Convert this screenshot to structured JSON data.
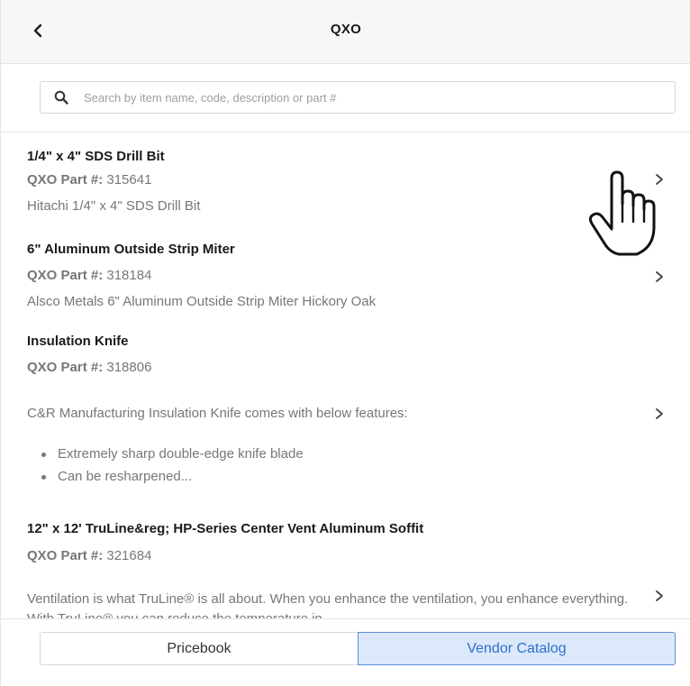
{
  "header": {
    "title": "QXO",
    "back_icon": "chevron-left-icon"
  },
  "search": {
    "placeholder": "Search by item name, code, description or part #",
    "value": "",
    "icon": "search-icon"
  },
  "items": [
    {
      "title": "1/4\" x 4\" SDS Drill Bit",
      "part_label": "QXO Part #:",
      "part_number": "315641",
      "description": "Hitachi 1/4\" x 4\" SDS Drill Bit"
    },
    {
      "title": "6\" Aluminum Outside Strip Miter",
      "part_label": "QXO Part #:",
      "part_number": "318184",
      "description": "Alsco Metals 6\" Aluminum Outside Strip Miter Hickory Oak"
    },
    {
      "title": "Insulation Knife",
      "part_label": "QXO Part #:",
      "part_number": "318806",
      "description": "C&R Manufacturing Insulation Knife comes with below features:",
      "bullets": [
        "Extremely sharp double-edge knife blade",
        "Can be resharpened..."
      ]
    },
    {
      "title": "12\" x 12' TruLine&reg; HP-Series Center Vent Aluminum Soffit",
      "part_label": "QXO Part #:",
      "part_number": "321684",
      "description": "Ventilation is what TruLine® is all about. When you enhance the ventilation, you enhance everything. With TruLine® you can reduce the temperature in"
    }
  ],
  "footer": {
    "tabs": [
      {
        "label": "Pricebook",
        "selected": false
      },
      {
        "label": "Vendor Catalog",
        "selected": true
      }
    ]
  },
  "colors": {
    "accent": "#2f6fc9",
    "selected_tab_bg": "#dbe9fb",
    "header_bg": "#f7f7f7",
    "muted_text": "#777777"
  },
  "cursor": "hand-pointer-icon"
}
